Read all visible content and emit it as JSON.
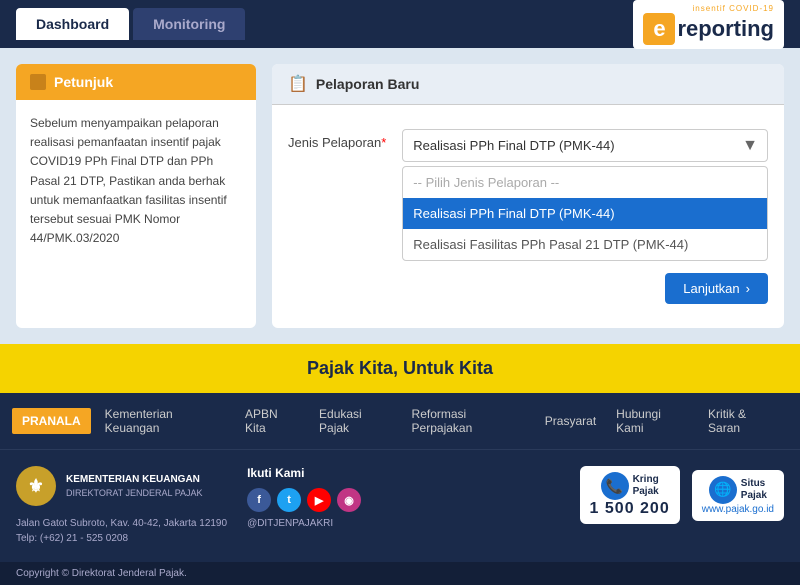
{
  "header": {
    "tabs": [
      {
        "label": "Dashboard",
        "active": true
      },
      {
        "label": "Monitoring",
        "active": false
      }
    ],
    "logo": {
      "e_letter": "e",
      "covid_label": "insentif COVID-19",
      "reporting_label": "reporting"
    }
  },
  "petunjuk": {
    "title": "Petunjuk",
    "body": "Sebelum menyampaikan pelaporan realisasi pemanfaatan insentif pajak COVID19 PPh Final DTP dan PPh Pasal 21 DTP, Pastikan anda berhak untuk memanfaatkan fasilitas insentif tersebut sesuai PMK Nomor 44/PMK.03/2020"
  },
  "pelaporan": {
    "title": "Pelaporan Baru",
    "field_label": "Jenis Pelaporan",
    "required_mark": "*",
    "selected_value": "Realisasi PPh Final DTP (PMK-44)",
    "dropdown_items": [
      {
        "label": "-- Pilih Jenis Pelaporan --",
        "type": "placeholder"
      },
      {
        "label": "Realisasi PPh Final DTP (PMK-44)",
        "type": "highlighted"
      },
      {
        "label": "Realisasi Fasilitas PPh Pasal 21 DTP (PMK-44)",
        "type": "normal"
      }
    ],
    "button_label": "Lanjutkan",
    "button_arrow": "›"
  },
  "yellow_banner": {
    "text": "Pajak Kita, Untuk Kita"
  },
  "footer": {
    "nav_items": [
      {
        "label": "PRANALA",
        "active": true
      },
      {
        "label": "Kementerian Keuangan",
        "active": false
      },
      {
        "label": "APBN Kita",
        "active": false
      },
      {
        "label": "Edukasi Pajak",
        "active": false
      },
      {
        "label": "Reformasi Perpajakan",
        "active": false
      },
      {
        "label": "Prasyarat",
        "active": false
      },
      {
        "label": "Hubungi Kami",
        "active": false
      },
      {
        "label": "Kritik & Saran",
        "active": false
      }
    ],
    "org_name": "KEMENTERIAN KEUANGAN",
    "org_sub": "DIREKTORAT JENDERAL PAJAK",
    "address_line1": "Jalan Gatot Subroto, Kav. 40-42, Jakarta 12190",
    "address_line2": "Telp: (+62) 21 - 525 0208",
    "ikuti_kami": "Ikuti Kami",
    "social_handle": "@DITJENPAJAKRI",
    "kring_label": "Kring\nPajak",
    "kring_number": "1 500 200",
    "situs_label": "Situs\nPajak",
    "situs_url": "www.pajak.go.id",
    "copyright": "Copyright © Direktorat Jenderal Pajak."
  }
}
